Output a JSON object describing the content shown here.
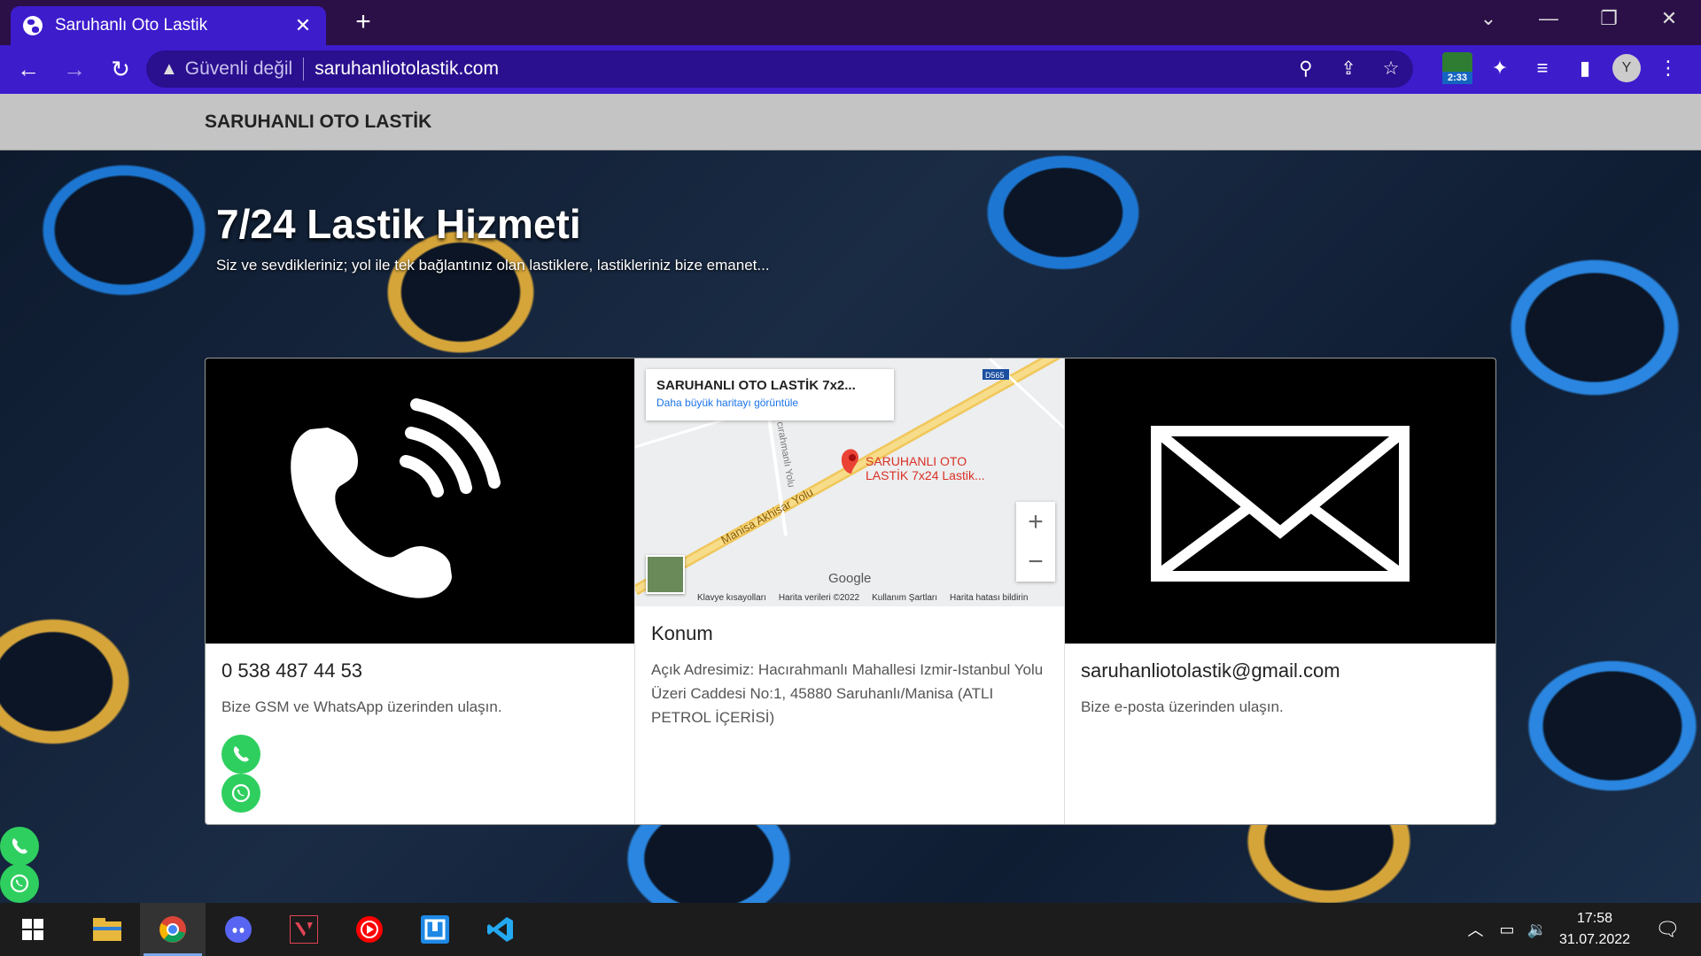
{
  "browser": {
    "tab_title": "Saruhanlı Oto Lastik",
    "security_label": "Güvenli değil",
    "url": "saruhanliotolastik.com",
    "extension_badge": "2:33",
    "profile_initial": "Y"
  },
  "site": {
    "brand": "SARUHANLI OTO LASTİK",
    "hero_title": "7/24 Lastik Hizmeti",
    "hero_subtitle": "Siz ve sevdikleriniz; yol ile tek bağlantınız olan lastiklere, lastikleriniz bize emanet..."
  },
  "cards": {
    "phone": {
      "title": "0 538 487 44 53",
      "text": "Bize GSM ve WhatsApp üzerinden ulaşın."
    },
    "location": {
      "title": "Konum",
      "text": "Açık Adresimiz: Hacırahmanlı Mahallesi Izmir-Istanbul Yolu Üzeri Caddesi No:1, 45880 Saruhanlı/Manisa (ATLI PETROL İÇERİSİ)"
    },
    "email": {
      "title": "saruhanliotolastik@gmail.com",
      "text": "Bize e-posta üzerinden ulaşın."
    }
  },
  "map": {
    "place_name": "SARUHANLI OTO LASTİK 7x2...",
    "larger_map_link": "Daha büyük haritayı görüntüle",
    "pin_label_line1": "SARUHANLI OTO",
    "pin_label_line2": "LASTİK 7x24 Lastik...",
    "road_main": "Manisa Akhisar Yolu",
    "road_side": "cırahmanlı Yolu",
    "road_shield": "D565",
    "zoom_in": "+",
    "zoom_out": "−",
    "google": "Google",
    "footer": [
      "Klavye kısayolları",
      "Harita verileri ©2022",
      "Kullanım Şartları",
      "Harita hatası bildirin"
    ]
  },
  "taskbar": {
    "time": "17:58",
    "date": "31.07.2022"
  },
  "colors": {
    "tab_active": "#3d1ccc",
    "tabstrip": "#2b0f47",
    "whatsapp_green": "#2fcf5f",
    "navbar_bg": "#c4c4c4"
  }
}
